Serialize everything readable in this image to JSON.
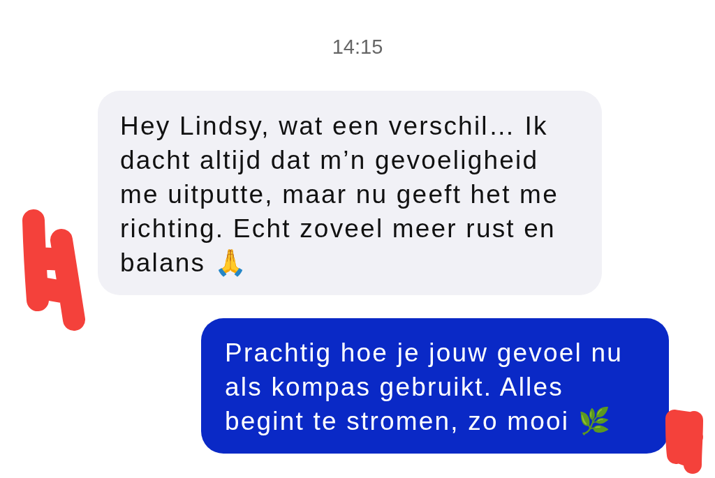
{
  "timestamp": "14:15",
  "messages": [
    {
      "kind": "received",
      "text": "Hey Lindsy, wat een verschil… Ik dacht altijd dat m’n gevoeligheid me uitputte, maar nu geeft het me richting. Echt zoveel meer rust en balans 🙏"
    },
    {
      "kind": "sent",
      "text": "Prachtig hoe je jouw gevoel nu als kompas gebruikt. Alles begint te stromen, zo mooi 🌿"
    }
  ]
}
